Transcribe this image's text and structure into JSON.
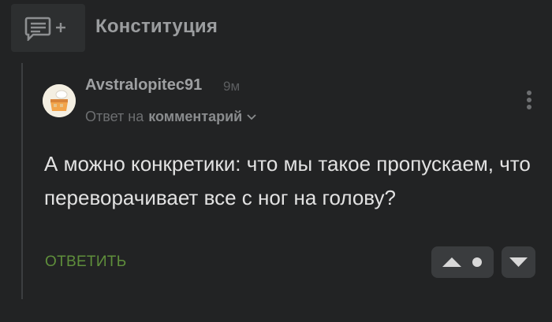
{
  "header": {
    "tag_title": "Конституция",
    "add_icon": "comment-add-icon"
  },
  "comment": {
    "author": "Avstralopitec91",
    "time": "9м",
    "reply_prefix": "Ответ на",
    "reply_link": "комментарий",
    "text": "А можно конкретики: что мы такое пропускаем, что переворачивает все с ног на голову?",
    "reply_label": "ОТВЕТИТЬ",
    "icons": {
      "avatar": "avatar-cake-icon",
      "chevron": "chevron-down-icon",
      "more": "more-vertical-icon",
      "upvote": "upvote-arrow-icon",
      "downvote": "downvote-arrow-icon"
    }
  },
  "colors": {
    "background": "#222324",
    "reply_accent": "#5f8f3b",
    "vote_button": "#3a3c3e"
  }
}
